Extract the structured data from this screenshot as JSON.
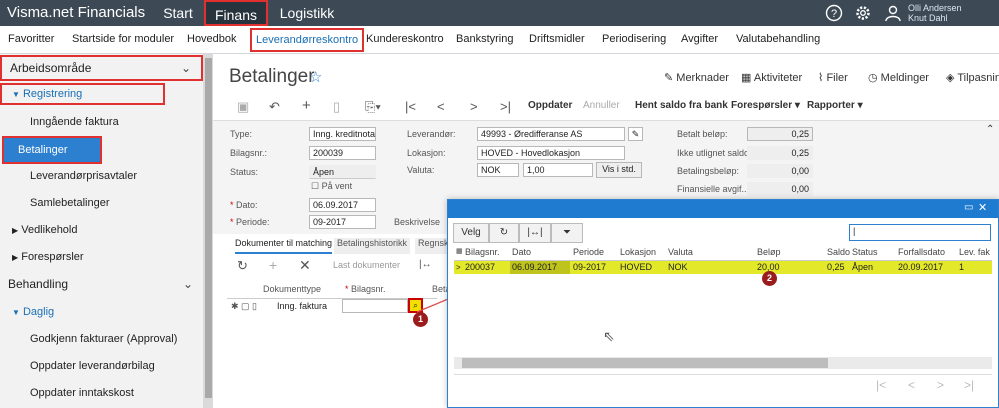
{
  "topbar": {
    "brand": "Visma.net Financials",
    "nav": [
      "Start",
      "Finans",
      "Logistikk"
    ],
    "user_line1": "Olli Andersen",
    "user_line2": "Knut Dahl"
  },
  "modules": [
    "Favoritter",
    "Startside for moduler",
    "Hovedbok",
    "Leverandørreskontro",
    "Kundereskontro",
    "Bankstyring",
    "Driftsmidler",
    "Periodisering",
    "Avgifter",
    "Valutabehandling"
  ],
  "sidebar": {
    "workspace": "Arbeidsområde",
    "registrering": "Registrering",
    "reg_items": [
      "Inngående faktura",
      "Betalinger",
      "Leverandørprisavtaler",
      "Samlebetalinger"
    ],
    "groups": [
      "Vedlikehold",
      "Forespørsler"
    ],
    "behandling": "Behandling",
    "daglig": "Daglig",
    "daglig_items": [
      "Godkjenn fakturaer (Approval)",
      "Oppdater leverandørbilag",
      "Oppdater inntakskost"
    ]
  },
  "page": {
    "title": "Betalinger",
    "actions": [
      "Merknader",
      "Aktiviteter",
      "Filer",
      "Meldinger",
      "Tilpasning"
    ],
    "toolbar": {
      "oppdater": "Oppdater",
      "annuller": "Annuller",
      "hent": "Hent saldo fra bank",
      "foresporsler": "Forespørsler",
      "rapporter": "Rapporter"
    }
  },
  "form": {
    "type_l": "Type:",
    "type_v": "Inng. kreditnota",
    "bilag_l": "Bilagsnr.:",
    "bilag_v": "200039",
    "status_l": "Status:",
    "status_v": "Åpen",
    "pavent": "På vent",
    "dato_l": "Dato:",
    "dato_v": "06.09.2017",
    "periode_l": "Periode:",
    "periode_v": "09-2017",
    "lev_l": "Leverandør:",
    "lev_v": "49993 - Øredifferanse AS",
    "lok_l": "Lokasjon:",
    "lok_v": "HOVED - Hovedlokasjon",
    "val_l": "Valuta:",
    "val_v": "NOK",
    "val_rate": "1,00",
    "val_btn": "Vis i std.",
    "beskr_l": "Beskrivelse",
    "betalt_l": "Betalt beløp:",
    "betalt_v": "0,25",
    "ikke_l": "Ikke utlignet saldo:",
    "ikke_v": "0,25",
    "betbel_l": "Betalingsbeløp:",
    "betbel_v": "0,00",
    "fin_l": "Finansielle avgif...",
    "fin_v": "0,00"
  },
  "tabs": [
    "Dokumenter til matching",
    "Betalingshistorikk",
    "Regnskap"
  ],
  "grid": {
    "last": "Last dokumenter",
    "h_doktype": "Dokumenttype",
    "h_bilag": "Bilagsnr.",
    "h_beta": "Beta",
    "row_doktype": "Inng. faktura"
  },
  "popup": {
    "velg": "Velg",
    "headers": [
      "Bilagsnr.",
      "Dato",
      "Periode",
      "Lokasjon",
      "Valuta",
      "Beløp",
      "Saldo",
      "Status",
      "Forfallsdato",
      "Lev. fak"
    ],
    "row": [
      "200037",
      "06.09.2017",
      "09-2017",
      "HOVED",
      "NOK",
      "20,00",
      "0,25",
      "Åpen",
      "20.09.2017",
      "1"
    ]
  },
  "callouts": [
    "1",
    "2"
  ]
}
